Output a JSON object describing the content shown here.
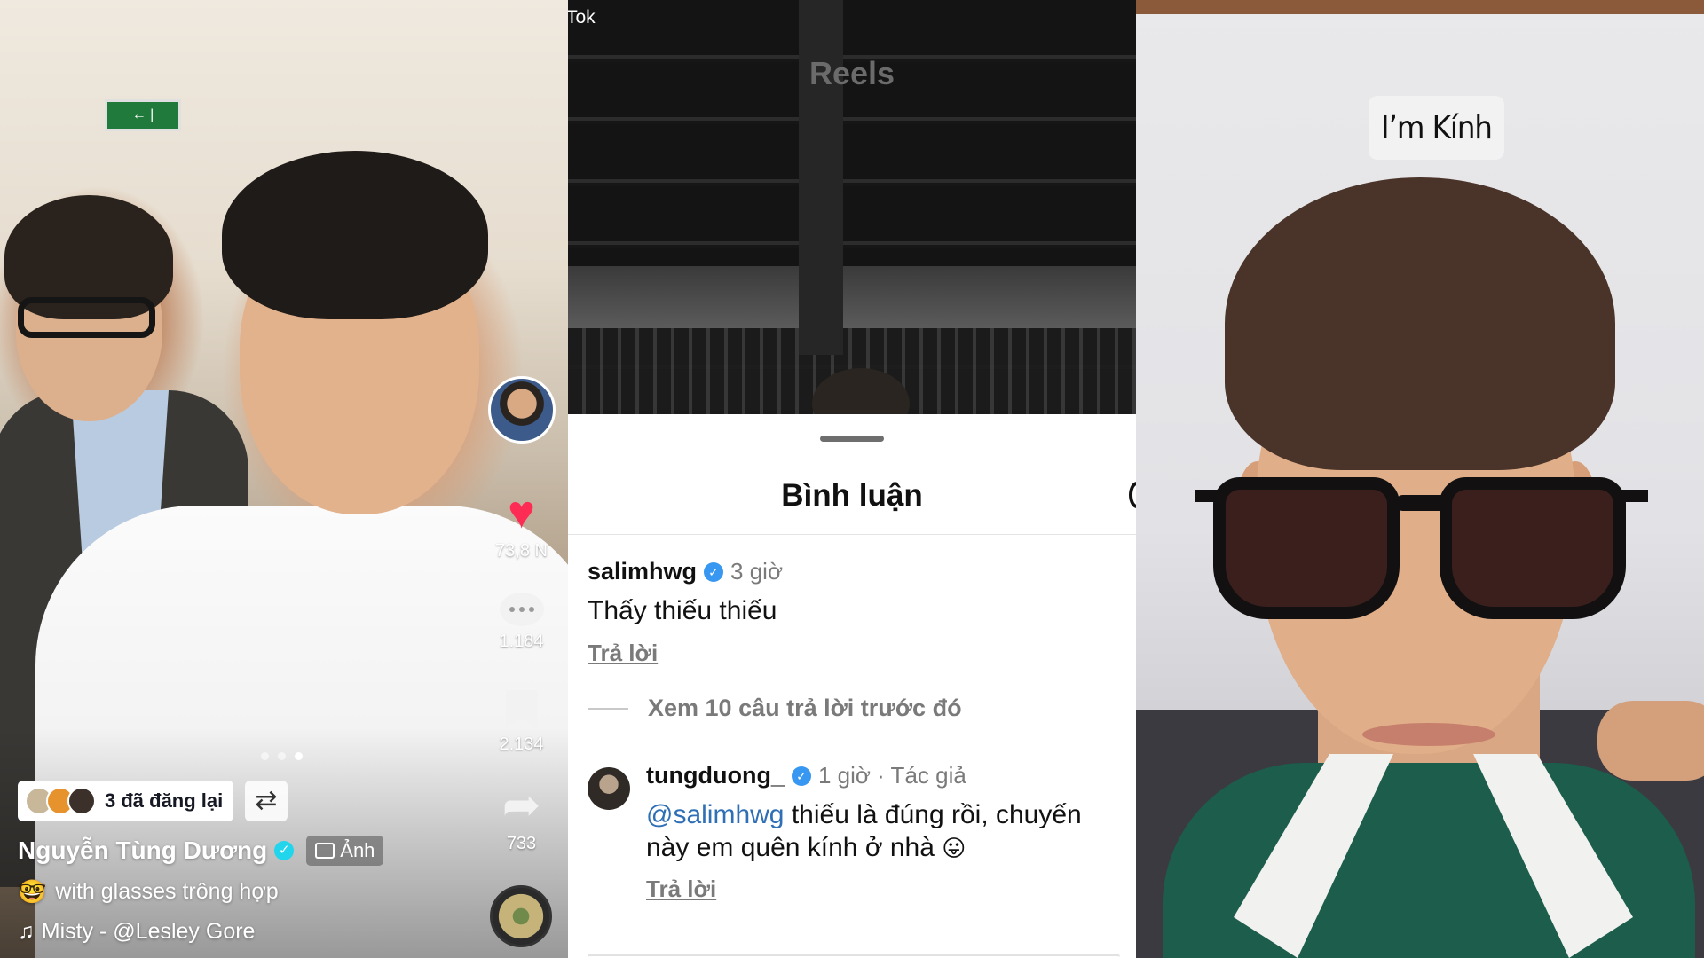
{
  "panel_left": {
    "exit_sign": "← |",
    "rail": {
      "likes": "73,8 N",
      "comments": "1.184",
      "saves": "2.134",
      "shares": "733"
    },
    "repost_label": "3 đã đăng lại",
    "author_name": "Nguyễn Tùng Dương",
    "photo_tag": "Ảnh",
    "caption_emoji": "🤓",
    "caption": "with glasses trông hợp",
    "music_note": "♫",
    "music": "Misty - @Lesley Gore",
    "colors": {
      "like_heart": "#fe2c55",
      "verified": "#20d5ec"
    }
  },
  "panel_middle": {
    "app_label": "Tok",
    "video_label": "Reels",
    "sheet_title": "Bình luận",
    "comments": [
      {
        "user": "salimhwg",
        "time": "3 giờ",
        "text": "Thấy thiếu thiếu",
        "reply": "Trả lời"
      }
    ],
    "view_previous": "Xem 10 câu trả lời trước đó",
    "reply": {
      "user": "tungduong_",
      "meta": "1 giờ · Tác giả",
      "mention": "@salimhwg",
      "text": " thiếu là đúng rồi, chuyến này em quên kính ở nhà",
      "emoji": "😛",
      "reply_label": "Trả lời"
    },
    "colors": {
      "mention": "#2f6fb5",
      "verified": "#3897f0"
    }
  },
  "panel_right": {
    "sticker_text": "I’m Kính"
  }
}
